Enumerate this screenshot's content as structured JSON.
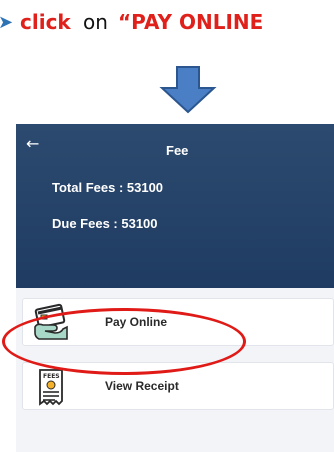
{
  "instruction": {
    "arrow_icon": "arrow-right-icon",
    "word_click": "click",
    "word_on": "on",
    "word_target": "“PAY ONLINE",
    "colors": {
      "emphasis": "#e0201b",
      "arrow": "#2e74b5"
    }
  },
  "down_arrow_icon": "arrow-down-icon",
  "app": {
    "back_icon": "back-arrow-icon",
    "title": "Fee",
    "total_fees": "Total Fees : 53100",
    "due_fees": "Due Fees : 53100",
    "header_color": "#1f3b62"
  },
  "actions": [
    {
      "label": "Pay Online",
      "icon": "card-payment-icon"
    },
    {
      "label": "View Receipt",
      "icon": "fees-receipt-icon"
    }
  ],
  "annotation": {
    "color": "#e01a16",
    "target": "Pay Online"
  }
}
